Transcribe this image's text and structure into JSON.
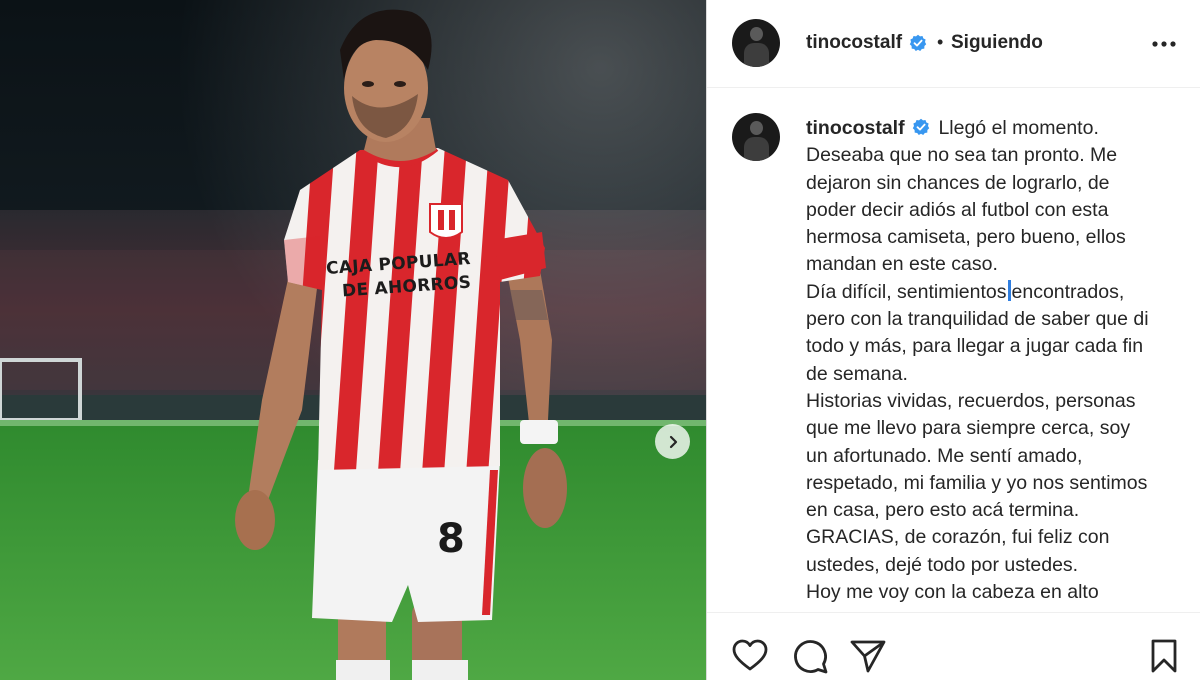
{
  "post": {
    "username": "tinocostalf",
    "follow_status": "Siguiendo",
    "separator": "•",
    "jersey": {
      "sponsor_line1": "CAJA POPULAR",
      "sponsor_line2": "DE AHORROS",
      "number": "8"
    }
  },
  "caption": {
    "username": "tinocostalf",
    "lines": [
      "Llegó el momento.",
      "Deseaba que no sea tan pronto. Me dejaron sin chances de lograrlo, de poder decir adiós al futbol con esta hermosa camiseta, pero bueno, ellos mandan en este caso.",
      "Día difícil, sentimientos",
      "encontrados, pero con la tranquilidad de saber que di todo y más, para llegar a jugar cada fin de semana.",
      "Historias vividas, recuerdos, personas que me llevo para siempre cerca, soy un afortunado. Me sentí amado, respetado, mi familia y yo nos sentimos en casa, pero esto acá termina.",
      "GRACIAS, de corazón, fui feliz con ustedes, dejé todo por ustedes.",
      "Hoy me voy con la cabeza en alto"
    ]
  },
  "colors": {
    "verified": "#3897f0",
    "text": "#262626",
    "jersey_red": "#d9262c",
    "pitch": "#3f9a3a"
  },
  "icons": {
    "like": "heart-icon",
    "comment": "comment-icon",
    "share": "share-icon",
    "save": "bookmark-icon",
    "more": "more-options-icon",
    "next": "chevron-right-icon",
    "verified": "verified-badge-icon"
  }
}
